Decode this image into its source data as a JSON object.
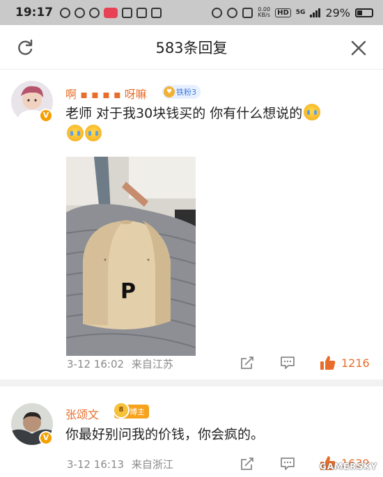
{
  "status_bar": {
    "time": "19:17",
    "net_speed_value": "0.00",
    "net_speed_unit": "KB/s",
    "hd_label": "HD",
    "network_label": "5G",
    "battery": "29%",
    "icons_left": [
      "weibo-icon",
      "wechat-icon",
      "location-icon",
      "red-app-icon",
      "app-icon",
      "tiktok-icon",
      "app-icon"
    ],
    "icons_right": [
      "alarm-icon",
      "location-icon",
      "vibrate-icon"
    ]
  },
  "header": {
    "title": "583条回复",
    "refresh_icon": "refresh-icon",
    "close_icon": "close-icon"
  },
  "comments": [
    {
      "username": "啊   ▪  ▪ ▪  ▪ 呀嘛",
      "badge_label": "铁粉3",
      "text_line1": "老师 对于我30块钱买的 你有什么想说的",
      "emojis": [
        "crying-emoji",
        "crying-emoji",
        "crying-emoji"
      ],
      "timestamp": "3-12 16:02",
      "location": "来自江苏",
      "likes": "1216",
      "photo_text": "P"
    },
    {
      "username": "张颂文",
      "badge_label": "博主",
      "text": "你最好别问我的价钱，你会疯的。",
      "timestamp": "3-12 16:13",
      "location": "来自浙江",
      "likes": "1639"
    }
  ],
  "watermark": "GAMERSKY",
  "colors": {
    "accent_orange": "#e86d2a",
    "badge_blue": "#3f7ad8",
    "verified_gold": "#f5a000",
    "meta_gray": "#8a8a8a",
    "status_bar_gray": "#c9c9c9"
  }
}
